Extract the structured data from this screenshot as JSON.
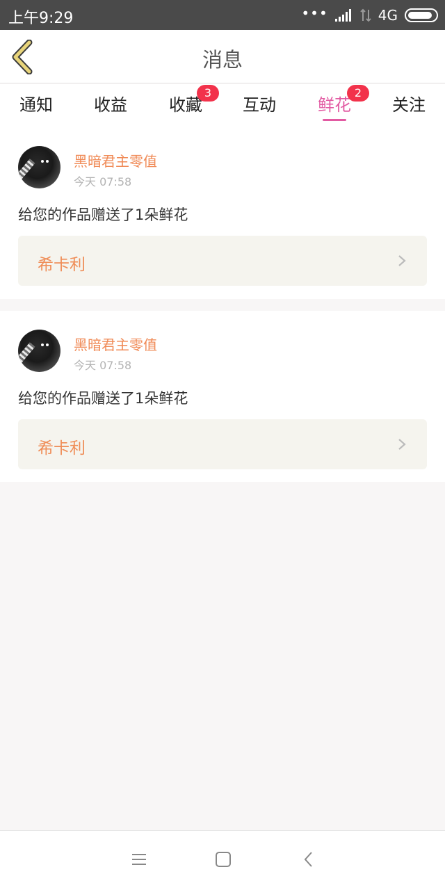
{
  "status_bar": {
    "time": "上午9:29",
    "network": "4G",
    "icons": [
      "more-dots-icon",
      "signal-icon",
      "data-arrows-icon",
      "battery-icon"
    ]
  },
  "header": {
    "title": "消息",
    "back_icon": "chevron-left-icon",
    "accent_color": "#e8d47a"
  },
  "tabs": [
    {
      "label": "通知",
      "badge": ""
    },
    {
      "label": "收益",
      "badge": ""
    },
    {
      "label": "收藏",
      "badge": "3"
    },
    {
      "label": "互动",
      "badge": ""
    },
    {
      "label": "鲜花",
      "badge": "2",
      "active": true
    },
    {
      "label": "关注",
      "badge": ""
    }
  ],
  "messages": [
    {
      "username": "黑暗君主零值",
      "time": "今天 07:58",
      "text": "给您的作品赠送了1朵鲜花",
      "work_title": "希卡利"
    },
    {
      "username": "黑暗君主零值",
      "time": "今天 07:58",
      "text": "给您的作品赠送了1朵鲜花",
      "work_title": "希卡利"
    }
  ],
  "colors": {
    "active_tab": "#e25aa2",
    "badge": "#f2324b",
    "username": "#f08a56",
    "work_title": "#ef8d57"
  },
  "system_nav": [
    "menu-icon",
    "home-square-icon",
    "back-chevron-icon"
  ]
}
